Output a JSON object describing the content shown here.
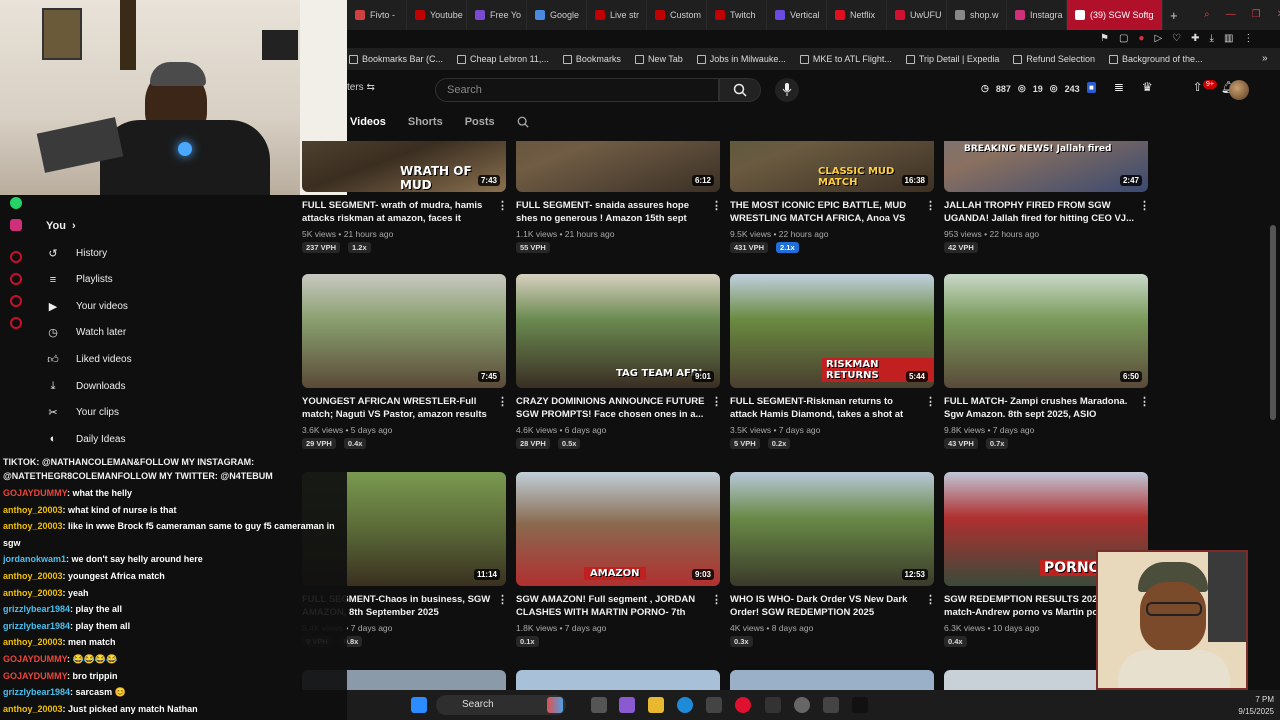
{
  "browser": {
    "tabs": [
      {
        "label": "Fivto -",
        "color": "#d04040"
      },
      {
        "label": "Youtube",
        "color": "#c00000"
      },
      {
        "label": "Free Yo",
        "color": "#7a4ad0"
      },
      {
        "label": "Google",
        "color": "#4a8ae0"
      },
      {
        "label": "Live str",
        "color": "#c00000"
      },
      {
        "label": "Custom",
        "color": "#c00000"
      },
      {
        "label": "Twitch",
        "color": "#c00000"
      },
      {
        "label": "Vertical",
        "color": "#6a4ae0"
      },
      {
        "label": "Netflix",
        "color": "#e01020"
      },
      {
        "label": "UwUFU",
        "color": "#d01030"
      },
      {
        "label": "shop.w",
        "color": "#888888"
      },
      {
        "label": "Instagra",
        "color": "#d0307a"
      },
      {
        "label": "(39) SGW Softg",
        "color": "#ffffff"
      }
    ],
    "bookmarks": [
      "Bookmarks Bar (C...",
      "Cheap Lebron 11,...",
      "Bookmarks",
      "New Tab",
      "Jobs in Milwauke...",
      "MKE to ATL Flight...",
      "Trip Detail | Expedia",
      "Refund Selection",
      "Background of the..."
    ]
  },
  "header": {
    "filters_label": "ters",
    "search_placeholder": "Search",
    "stats": {
      "subs": "887",
      "views": "19",
      "other": "243"
    },
    "notifications": "9+"
  },
  "channel_tabs": [
    "Videos",
    "Shorts",
    "Posts"
  ],
  "sidebar": {
    "you_label": "You",
    "items": [
      {
        "label": "History",
        "icon": "history-icon"
      },
      {
        "label": "Playlists",
        "icon": "playlists-icon"
      },
      {
        "label": "Your videos",
        "icon": "your-videos-icon"
      },
      {
        "label": "Watch later",
        "icon": "watch-later-icon"
      },
      {
        "label": "Liked videos",
        "icon": "liked-icon"
      },
      {
        "label": "Downloads",
        "icon": "download-icon"
      },
      {
        "label": "Your clips",
        "icon": "clips-icon"
      },
      {
        "label": "Daily Ideas",
        "icon": "ideas-icon"
      }
    ]
  },
  "chat": {
    "header_line1": "TIKTOK: @NATHANCOLEMAN&FOLLOW MY INSTAGRAM:",
    "header_line2": "@NATETHEGR8COLEMANFOLLOW MY TWITTER: @N4TEBUM",
    "messages": [
      {
        "user": "GOJAYDUMMY",
        "color": "#e8463c",
        "msg": ": what the helly"
      },
      {
        "user": "anthoy_20003",
        "color": "#f0c000",
        "msg": ": what kind of nurse is that"
      },
      {
        "user": "anthoy_20003",
        "color": "#f0c000",
        "msg": ": like in wwe Brock f5 cameraman same to guy f5 cameraman in"
      },
      {
        "user": "",
        "color": "#ffffff",
        "msg": "sgw"
      },
      {
        "user": "jordanokwam1",
        "color": "#48c0f0",
        "msg": ": we don't say helly around here"
      },
      {
        "user": "anthoy_20003",
        "color": "#f0c000",
        "msg": ": youngest Africa match"
      },
      {
        "user": "anthoy_20003",
        "color": "#f0c000",
        "msg": ": yeah"
      },
      {
        "user": "grizzlybear1984",
        "color": "#48c0f0",
        "msg": ": play the all"
      },
      {
        "user": "grizzlybear1984",
        "color": "#48c0f0",
        "msg": ": play them all"
      },
      {
        "user": "anthoy_20003",
        "color": "#f0c000",
        "msg": ": men match"
      },
      {
        "user": "GOJAYDUMMY",
        "color": "#e8463c",
        "msg": ": 😂😂😂😂"
      },
      {
        "user": "GOJAYDUMMY",
        "color": "#e8463c",
        "msg": ": bro trippin"
      },
      {
        "user": "grizzlybear1984",
        "color": "#48c0f0",
        "msg": ": sarcasm 😊"
      },
      {
        "user": "anthoy_20003",
        "color": "#f0c000",
        "msg": ": Just picked any match Nathan"
      }
    ]
  },
  "videos": [
    {
      "title": "FULL SEGMENT- wrath of mudra, hamis attacks riskman at amazon, faces it rought...",
      "views": "5K views • 21 hours ago",
      "vph": "237 VPH",
      "mult": "1.2x",
      "dur": "7:43",
      "label": "WRATH OF MUD"
    },
    {
      "title": "FULL SEGMENT- snaida assures hope shes no generous ! Amazon 15th sept 2025!...",
      "views": "1.1K views • 21 hours ago",
      "vph": "55 VPH",
      "mult": "",
      "dur": "6:12",
      "label": ""
    },
    {
      "title": "THE MOST ICONIC EPIC BATTLE, MUD WRESTLING MATCH AFRICA, Anoa VS Arm...",
      "views": "9.5K views • 22 hours ago",
      "vph": "431 VPH",
      "mult": "2.1x",
      "dur": "16:38",
      "label": "CLASSIC MUD MATCH"
    },
    {
      "title": "JALLAH TROPHY FIRED FROM SGW UGANDA! Jallah fired for hitting CEO VJ...",
      "views": "953 views • 22 hours ago",
      "vph": "42 VPH",
      "mult": "",
      "dur": "2:47",
      "label": "BREAKING NEWS! Jallah fired"
    },
    {
      "title": "YOUNGEST AFRICAN WRESTLER-Full match; Naguti VS Pastor, amazon results 8 th sept...",
      "views": "3.6K views • 5 days ago",
      "vph": "29 VPH",
      "mult": "0.4x",
      "dur": "7:45",
      "label": ""
    },
    {
      "title": "CRAZY DOMINIONS ANNOUNCE FUTURE SGW PROMPTS! Face chosen ones in a...",
      "views": "4.6K views • 6 days ago",
      "vph": "28 VPH",
      "mult": "0.5x",
      "dur": "9:01",
      "label": "TAG TEAM AFRI"
    },
    {
      "title": "FULL SEGMENT-Riskman returns to attack Hamis Diamond, takes a shot at the SGW...",
      "views": "3.5K views • 7 days ago",
      "vph": "5 VPH",
      "mult": "0.2x",
      "dur": "5:44",
      "label": "RISKMAN RETURNS"
    },
    {
      "title": "FULL MATCH- Zampi crushes Maradona. Sgw Amazon. 8th sept 2025, ASIO attacks...",
      "views": "9.8K views • 7 days ago",
      "vph": "43 VPH",
      "mult": "0.7x",
      "dur": "6:50",
      "label": ""
    },
    {
      "title": "FULL SEGMENT-Chaos in business, SGW AMAZON, 8th September 2025",
      "views": "8.4K views • 7 days ago",
      "vph": "9 VPH",
      "mult": "0.8x",
      "dur": "11:14",
      "label": ""
    },
    {
      "title": "SGW AMAZON! Full segment , JORDAN CLASHES WITH MARTIN PORNO- 7th sept...",
      "views": "1.8K views • 7 days ago",
      "vph": "",
      "mult": "0.1x",
      "dur": "9:03",
      "label": "AMAZON"
    },
    {
      "title": "WHO IS WHO- Dark Order VS New Dark Order! SGW REDEMPTION 2025",
      "views": "4K views • 8 days ago",
      "vph": "",
      "mult": "0.3x",
      "dur": "12:53",
      "label": ""
    },
    {
      "title": "SGW REDEMPTION RESULTS 2025! match-Andrew porno vs Martin porn",
      "views": "6.3K views • 10 days ago",
      "vph": "",
      "mult": "0.4x",
      "dur": "",
      "label": "PORNO"
    }
  ],
  "taskbar": {
    "search_label": "Search",
    "time": "7 PM",
    "date": "9/15/2025"
  }
}
